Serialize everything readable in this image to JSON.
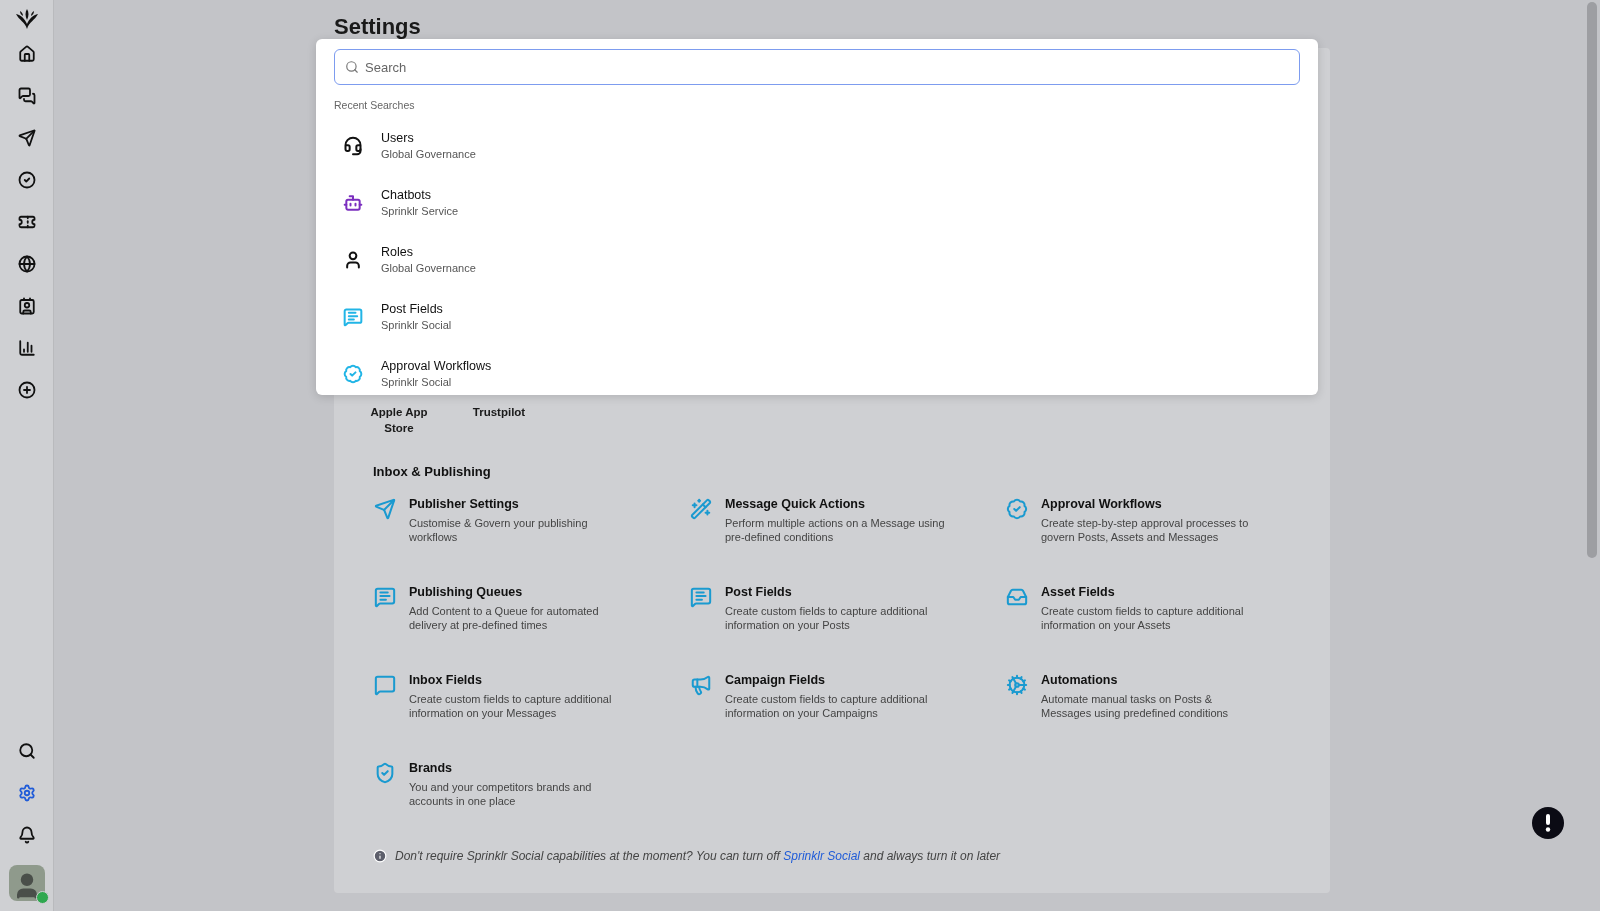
{
  "sidebar": {
    "items": [
      {
        "selected": false
      },
      {
        "selected": false
      },
      {
        "selected": false
      },
      {
        "selected": false
      },
      {
        "selected": false
      },
      {
        "selected": false
      },
      {
        "selected": false
      },
      {
        "selected": false
      },
      {
        "selected": false
      }
    ],
    "bottom_items": [
      {
        "selected": false
      },
      {
        "selected": true
      },
      {
        "selected": false
      }
    ],
    "avatar": {
      "online": true
    }
  },
  "page": {
    "title": "Settings"
  },
  "card": {
    "apps": [
      "Apple App Store",
      "Trustpilot"
    ],
    "section": {
      "title": "Inbox & Publishing",
      "items": [
        {
          "title": "Publisher Settings",
          "description": "Customise & Govern your publishing workflows"
        },
        {
          "title": "Message Quick Actions",
          "description": "Perform multiple actions on a Message using pre-defined conditions"
        },
        {
          "title": "Approval Workflows",
          "description": "Create step-by-step approval processes to govern Posts, Assets and Messages"
        },
        {
          "title": "Publishing Queues",
          "description": "Add Content to a Queue for automated delivery at pre-defined times"
        },
        {
          "title": "Post Fields",
          "description": "Create custom fields to capture additional information on your Posts"
        },
        {
          "title": "Asset Fields",
          "description": "Create custom fields to capture additional information on your Assets"
        },
        {
          "title": "Inbox Fields",
          "description": "Create custom fields to capture additional information on your Messages"
        },
        {
          "title": "Campaign Fields",
          "description": "Create custom fields to capture additional information on your Campaigns"
        },
        {
          "title": "Automations",
          "description": "Automate manual tasks on Posts & Messages using predefined conditions"
        },
        {
          "title": "Brands",
          "description": "You and your competitors brands and accounts in one place"
        }
      ]
    },
    "note": {
      "before": "Don't require Sprinklr Social capabilities at the moment? You can turn off ",
      "link": "Sprinklr Social",
      "after": " and always turn it on later"
    }
  },
  "search_popup": {
    "placeholder": "Search",
    "recent_label": "Recent Searches",
    "items": [
      {
        "title": "Users",
        "subtitle": "Global Governance"
      },
      {
        "title": "Chatbots",
        "subtitle": "Sprinklr Service"
      },
      {
        "title": "Roles",
        "subtitle": "Global Governance"
      },
      {
        "title": "Post Fields",
        "subtitle": "Sprinklr Social"
      },
      {
        "title": "Approval Workflows",
        "subtitle": "Sprinklr Social"
      }
    ]
  }
}
